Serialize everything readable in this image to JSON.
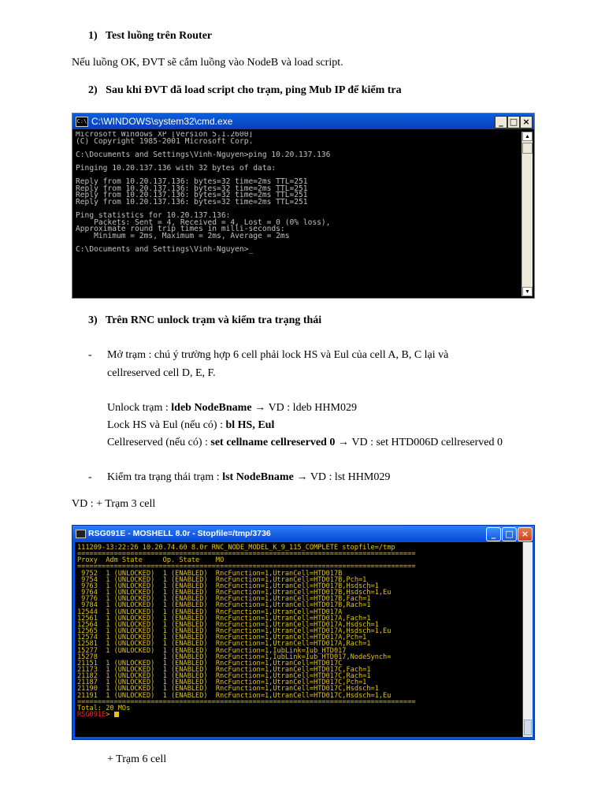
{
  "section1": {
    "number": "1)",
    "title": "Test luồng trên Router"
  },
  "intro_text": "Nếu luồng OK, ĐVT sẽ cắm luồng vào NodeB và load script.",
  "section2": {
    "number": "2)",
    "title": "Sau khi ĐVT đã load script cho trạm, ping Mub IP để kiểm tra"
  },
  "cmd_window": {
    "title": "C:\\WINDOWS\\system32\\cmd.exe",
    "buttons": {
      "minimize": "_",
      "maximize": "□",
      "close": "×"
    },
    "lines": [
      "Microsoft Windows XP [Version 5.1.2600]",
      "(C) Copyright 1985-2001 Microsoft Corp.",
      "",
      "C:\\Documents and Settings\\Vinh-Nguyen>ping 10.20.137.136",
      "",
      "Pinging 10.20.137.136 with 32 bytes of data:",
      "",
      "Reply from 10.20.137.136: bytes=32 time=2ms TTL=251",
      "Reply from 10.20.137.136: bytes=32 time=2ms TTL=251",
      "Reply from 10.20.137.136: bytes=32 time=2ms TTL=251",
      "Reply from 10.20.137.136: bytes=32 time=2ms TTL=251",
      "",
      "Ping statistics for 10.20.137.136:",
      "    Packets: Sent = 4, Received = 4, Lost = 0 (0% loss),",
      "Approximate round trip times in milli-seconds:",
      "    Minimum = 2ms, Maximum = 2ms, Average = 2ms",
      "",
      "C:\\Documents and Settings\\Vinh-Nguyen>_"
    ]
  },
  "section3": {
    "number": "3)",
    "title": "Trên RNC unlock trạm và kiểm tra trạng thái"
  },
  "bullet1": {
    "dash": "-",
    "line1": "Mở trạm : chú ý trường hợp 6 cell phải lock HS và Eul của cell A, B, C lại và",
    "line2": "cellreserved cell D, E, F."
  },
  "unlock": {
    "label": "Unlock trạm : ",
    "cmd": "ldeb NodeBname",
    "arrow": " → ",
    "example": "VD : ldeb HHM029"
  },
  "lockhs": {
    "label": "Lock HS và Eul (nếu có) : ",
    "cmd": "bl HS, Eul"
  },
  "cellres": {
    "label": "Cellreserved (nếu có) : ",
    "cmd": "set cellname cellreserved 0",
    "arrow": " → ",
    "example": "VD : set HTD006D cellreserved 0"
  },
  "bullet2": {
    "dash": "-",
    "label": "Kiểm tra trạng thái trạm : ",
    "cmd": "lst NodeBname",
    "arrow": " → ",
    "example": "VD : lst HHM029"
  },
  "vd3cell": "VD : + Trạm 3 cell",
  "moshell": {
    "title": "RSG091E - MOSHELL 8.0r - Stopfile=/tmp/3736",
    "buttons": {
      "minimize": "_",
      "maximize": "□",
      "close": "×"
    },
    "header_line": "111209-13:22:26 10.20.74.60 8.0r RNC_NODE_MODEL_K_9_115_COMPLETE stopfile=/tmp",
    "divider": "===================================================================================",
    "columns": "Proxy  Adm State     Op. State    MO",
    "rows": [
      " 9752  1 (UNLOCKED)  1 (ENABLED)  RncFunction=1,UtranCell=HTD017B",
      " 9754  1 (UNLOCKED)  1 (ENABLED)  RncFunction=1,UtranCell=HTD017B,Pch=1",
      " 9763  1 (UNLOCKED)  1 (ENABLED)  RncFunction=1,UtranCell=HTD017B,Hsdsch=1",
      " 9764  1 (UNLOCKED)  1 (ENABLED)  RncFunction=1,UtranCell=HTD017B,Hsdsch=1,Eu",
      " 9776  1 (UNLOCKED)  1 (ENABLED)  RncFunction=1,UtranCell=HTD017B,Fach=1",
      " 9784  1 (UNLOCKED)  1 (ENABLED)  RncFunction=1,UtranCell=HTD017B,Rach=1",
      "12544  1 (UNLOCKED)  1 (ENABLED)  RncFunction=1,UtranCell=HTD017A",
      "12561  1 (UNLOCKED)  1 (ENABLED)  RncFunction=1,UtranCell=HTD017A,Fach=1",
      "12564  1 (UNLOCKED)  1 (ENABLED)  RncFunction=1,UtranCell=HTD017A,Hsdsch=1",
      "12565  1 (UNLOCKED)  1 (ENABLED)  RncFunction=1,UtranCell=HTD017A,Hsdsch=1,Eu",
      "12574  1 (UNLOCKED)  1 (ENABLED)  RncFunction=1,UtranCell=HTD017A,Pch=1",
      "12581  1 (UNLOCKED)  1 (ENABLED)  RncFunction=1,UtranCell=HTD017A,Rach=1",
      "15277  1 (UNLOCKED)  1 (ENABLED)  RncFunction=1,IubLink=Iub_HTD017",
      "15278                1 (ENABLED)  RncFunction=1,IubLink=Iub_HTD017,NodeSynch=",
      "21151  1 (UNLOCKED)  1 (ENABLED)  RncFunction=1,UtranCell=HTD017C",
      "21173  1 (UNLOCKED)  1 (ENABLED)  RncFunction=1,UtranCell=HTD017C,Fach=1",
      "21182  1 (UNLOCKED)  1 (ENABLED)  RncFunction=1,UtranCell=HTD017C,Rach=1",
      "21187  1 (UNLOCKED)  1 (ENABLED)  RncFunction=1,UtranCell=HTD017C,Pch=1",
      "21190  1 (UNLOCKED)  1 (ENABLED)  RncFunction=1,UtranCell=HTD017C,Hsdsch=1",
      "21191  1 (UNLOCKED)  1 (ENABLED)  RncFunction=1,UtranCell=HTD017C,Hsdsch=1,Eu"
    ],
    "total": "Total: 20 MOs",
    "prompt_name": "RSG091E",
    "prompt_suffix": "> "
  },
  "vd6cell": "+ Trạm 6 cell"
}
